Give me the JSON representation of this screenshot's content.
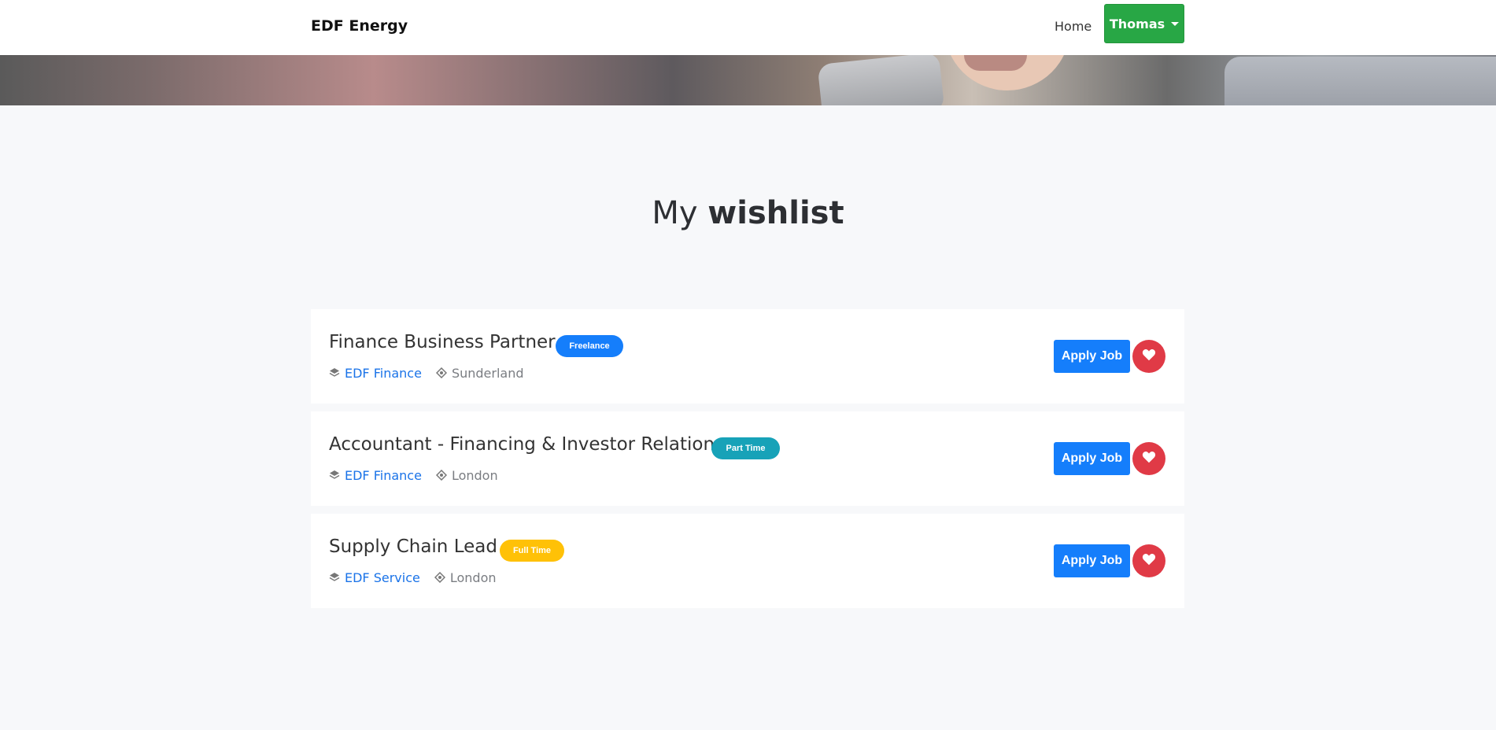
{
  "navbar": {
    "brand": "EDF Energy",
    "home_label": "Home",
    "user_label": "Thomas"
  },
  "page": {
    "title_light": "My",
    "title_bold": "wishlist"
  },
  "jobs": [
    {
      "title": "Finance Business Partner",
      "badge": "Freelance",
      "badge_color": "#157efb",
      "badge_text_color": "#ffffff",
      "company": "EDF Finance",
      "location": "Sunderland",
      "apply_label": "Apply Job"
    },
    {
      "title": "Accountant - Financing & Investor Relations",
      "badge": "Part Time",
      "badge_color": "#17a2b8",
      "badge_text_color": "#ffffff",
      "company": "EDF Finance",
      "location": "London",
      "apply_label": "Apply Job"
    },
    {
      "title": "Supply Chain Lead",
      "badge": "Full Time",
      "badge_color": "#ffc107",
      "badge_text_color": "#ffffff",
      "company": "EDF Service",
      "location": "London",
      "apply_label": "Apply Job"
    }
  ],
  "icons": {
    "company": "layers-icon",
    "location": "location-icon",
    "wishlist": "heart-icon"
  }
}
